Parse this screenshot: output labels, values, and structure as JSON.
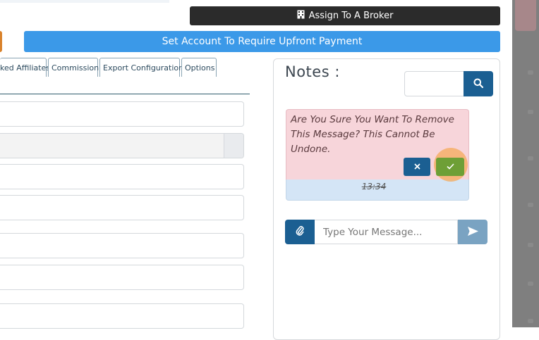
{
  "toolbar": {
    "broker_label": "Assign To A Broker",
    "upfront_label": "Set Account To Require Upfront Payment"
  },
  "tabs": [
    {
      "label": "ked Affiliates"
    },
    {
      "label": "Commission"
    },
    {
      "label": "Export Configuration"
    },
    {
      "label": "Options"
    }
  ],
  "notes": {
    "title": "Notes :",
    "search_value": "",
    "confirm_message": "Are You Sure You Want To Remove This Message? This Cannot Be Undone.",
    "message_time": "13:34",
    "composer_placeholder": "Type Your Message..."
  },
  "icons": {
    "broker": "building-icon",
    "search": "search-icon",
    "cancel": "close-icon",
    "confirm": "check-icon",
    "attach": "paperclip-icon",
    "send": "send-icon"
  },
  "colors": {
    "primary_dark": "#1b5f92",
    "upfront_blue": "#3b99e8",
    "confirm_green": "#6e9f36",
    "confirm_bg": "#f7d5da",
    "message_bg": "#d4e5f6",
    "dark_button": "#2b2b2b"
  }
}
